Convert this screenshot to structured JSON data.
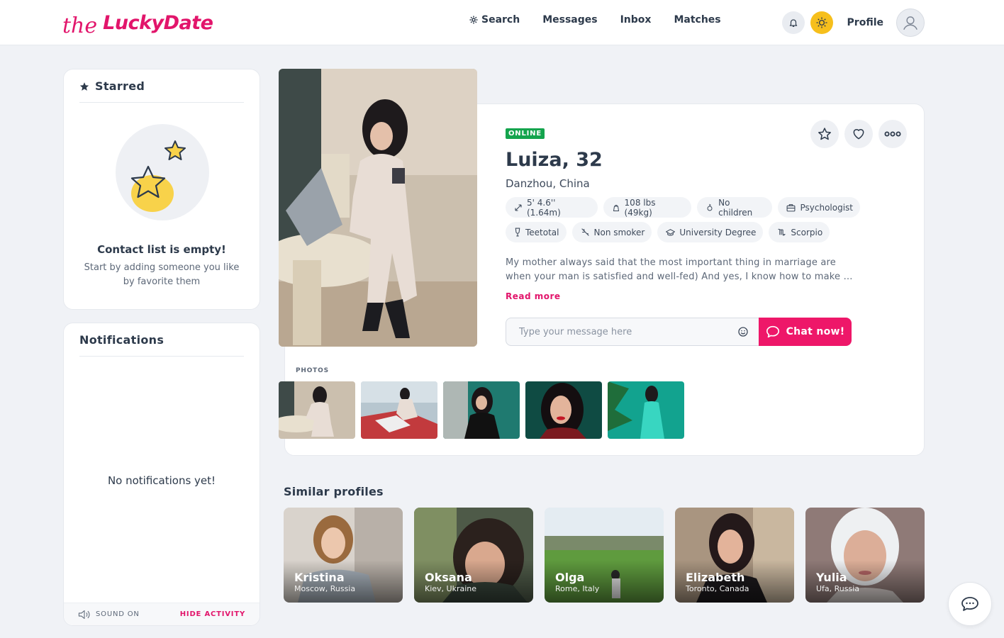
{
  "header": {
    "logo_the": "the",
    "logo_brand": "LuckyDate",
    "nav": {
      "search": "Search",
      "messages": "Messages",
      "inbox": "Inbox",
      "matches": "Matches"
    },
    "profile_label": "Profile"
  },
  "starred": {
    "title": "Starred",
    "empty_title": "Contact list is empty!",
    "empty_sub": "Start by adding someone you like by favorite them"
  },
  "notifications": {
    "title": "Notifications",
    "empty": "No notifications yet!",
    "sound_label": "SOUND ON",
    "hide_label": "HIDE ACTIVITY"
  },
  "profile": {
    "status": "ONLINE",
    "name_age": "Luiza, 32",
    "location": "Danzhou, China",
    "details_row1": [
      {
        "icon": "height-icon",
        "text": "5' 4.6'' (1.64m)"
      },
      {
        "icon": "weight-icon",
        "text": "108 lbs (49kg)"
      },
      {
        "icon": "children-icon",
        "text": "No children"
      },
      {
        "icon": "briefcase-icon",
        "text": "Psychologist"
      }
    ],
    "details_row2": [
      {
        "icon": "glass-icon",
        "text": "Teetotal"
      },
      {
        "icon": "no-smoking-icon",
        "text": "Non smoker"
      },
      {
        "icon": "graduation-icon",
        "text": "University Degree"
      },
      {
        "icon": "zodiac-icon",
        "text": "Scorpio"
      }
    ],
    "bio": "My mother always said that the most important thing in marriage are when your man is satisfied and well-fed) And yes, I know how to make …",
    "read_more": "Read more",
    "message_placeholder": "Type your message here",
    "chat_button": "Chat now!",
    "photos_label": "PHOTOS"
  },
  "similar": {
    "title": "Similar profiles",
    "profiles": [
      {
        "name": "Kristina",
        "location": "Moscow, Russia"
      },
      {
        "name": "Oksana",
        "location": "Kiev, Ukraine"
      },
      {
        "name": "Olga",
        "location": "Rome, Italy"
      },
      {
        "name": "Elizabeth",
        "location": "Toronto, Canada"
      },
      {
        "name": "Yulia",
        "location": "Ufa, Russia"
      }
    ]
  },
  "colors": {
    "brand": "#e2156b",
    "chat_button": "#ee1769",
    "online": "#14a44d",
    "sun": "#f6bf1c"
  }
}
